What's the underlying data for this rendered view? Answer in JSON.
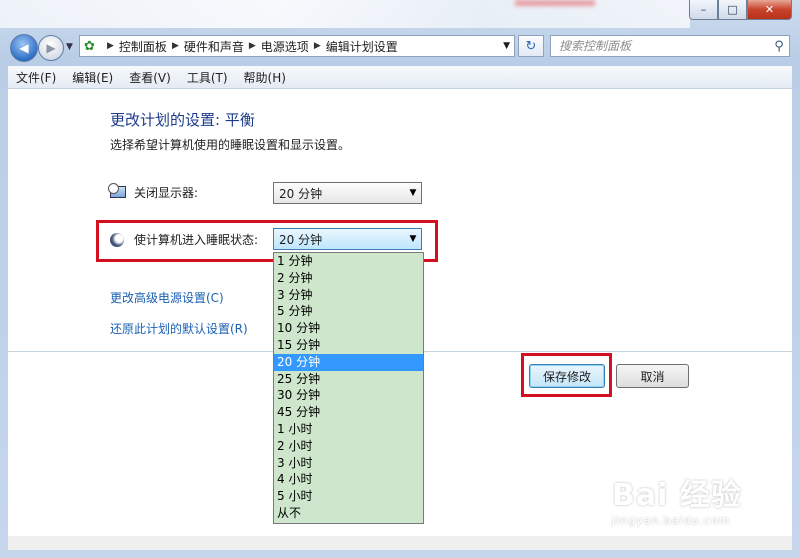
{
  "window": {
    "buttons": {
      "minimize": "–",
      "maximize": "□",
      "close": "✕"
    }
  },
  "address": {
    "breadcrumbs": [
      "控制面板",
      "硬件和声音",
      "电源选项",
      "编辑计划设置"
    ]
  },
  "search": {
    "placeholder": "搜索控制面板"
  },
  "menu": {
    "items": [
      "文件(F)",
      "编辑(E)",
      "查看(V)",
      "工具(T)",
      "帮助(H)"
    ]
  },
  "page": {
    "title": "更改计划的设置: 平衡",
    "subtitle": "选择希望计算机使用的睡眠设置和显示设置。",
    "display_off": {
      "label": "关闭显示器:",
      "value": "20 分钟"
    },
    "sleep": {
      "label": "使计算机进入睡眠状态:",
      "value": "20 分钟"
    },
    "links": {
      "advanced": "更改高级电源设置(C)",
      "restore": "还原此计划的默认设置(R)"
    },
    "buttons": {
      "save": "保存修改",
      "cancel": "取消"
    }
  },
  "dropdown": {
    "options": [
      "1 分钟",
      "2 分钟",
      "3 分钟",
      "5 分钟",
      "10 分钟",
      "15 分钟",
      "20 分钟",
      "25 分钟",
      "30 分钟",
      "45 分钟",
      "1 小时",
      "2 小时",
      "3 小时",
      "4 小时",
      "5 小时",
      "从不"
    ],
    "selected_index": 6,
    "colors": {
      "list_bg": "#cde6cc",
      "selected_bg": "#3399ff"
    }
  },
  "highlight_color": "#d40f1f",
  "watermark": {
    "logo": "Bai 经验",
    "url": "jingyan.baidu.com"
  }
}
